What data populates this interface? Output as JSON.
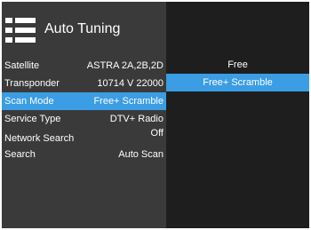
{
  "header": {
    "title": "Auto Tuning",
    "icon": "list-menu-icon"
  },
  "settings": [
    {
      "label": "Satellite",
      "value": "ASTRA 2A,2B,2D",
      "highlighted": false
    },
    {
      "label": "Transponder",
      "value": "10714 V 22000",
      "highlighted": false
    },
    {
      "label": "Scan Mode",
      "value": "Free+ Scramble",
      "highlighted": true
    },
    {
      "label": "Service Type",
      "value": "DTV+ Radio",
      "highlighted": false
    },
    {
      "label": "Network Search",
      "value": "Off",
      "highlighted": false
    },
    {
      "label": "Search",
      "value": "Auto Scan",
      "highlighted": false
    }
  ],
  "scan_mode_options": [
    {
      "label": "Free",
      "selected": false
    },
    {
      "label": "Free+ Scramble",
      "selected": true
    }
  ],
  "colors": {
    "highlight": "#3b9de3",
    "panel_left": "#3a3a3a",
    "panel_right": "#1e1e1e",
    "text": "#ffffff"
  }
}
